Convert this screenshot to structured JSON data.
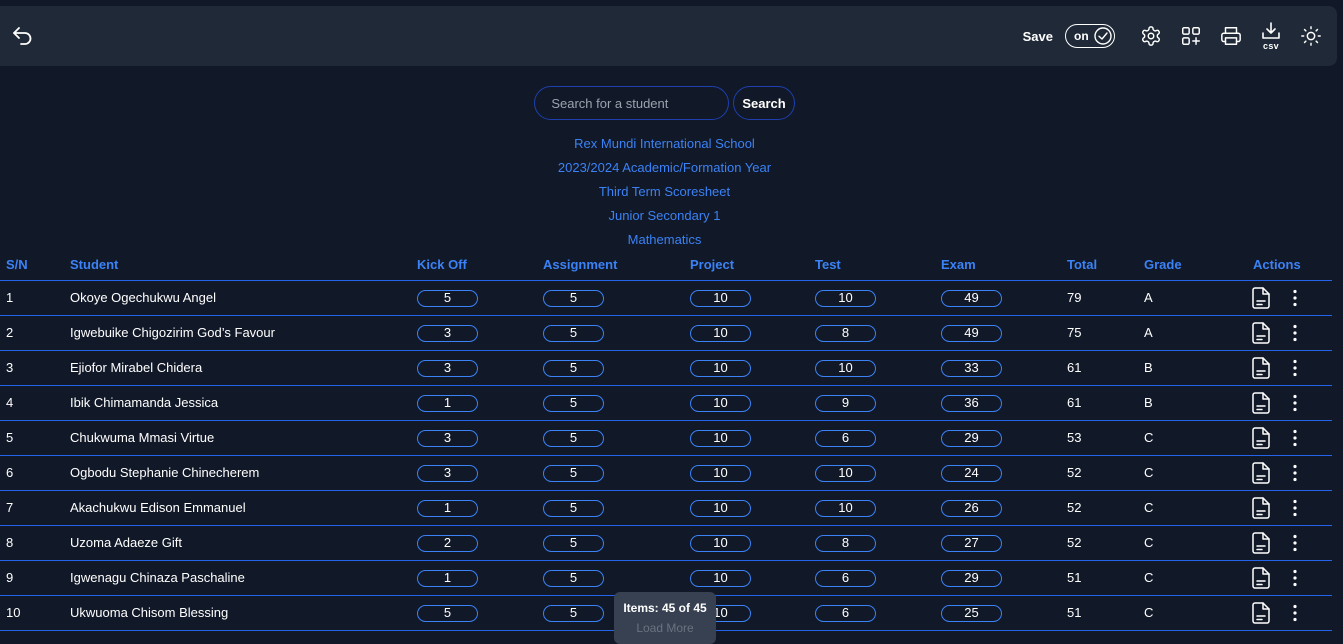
{
  "toolbar": {
    "save_label": "Save",
    "toggle_label": "on",
    "csv_label": "csv"
  },
  "search": {
    "placeholder": "Search for a student",
    "button_label": "Search"
  },
  "heading": [
    "Rex Mundi International School",
    "2023/2024 Academic/Formation Year",
    "Third Term Scoresheet",
    "Junior Secondary 1",
    "Mathematics"
  ],
  "table": {
    "headers": [
      "S/N",
      "Student",
      "Kick Off",
      "Assignment",
      "Project",
      "Test",
      "Exam",
      "Total",
      "Grade",
      "Actions"
    ],
    "rows": [
      {
        "sn": "1",
        "student": "Okoye Ogechukwu Angel",
        "kick_off": "5",
        "assignment": "5",
        "project": "10",
        "test": "10",
        "exam": "49",
        "total": "79",
        "grade": "A"
      },
      {
        "sn": "2",
        "student": "Igwebuike Chigozirim God’s Favour",
        "kick_off": "3",
        "assignment": "5",
        "project": "10",
        "test": "8",
        "exam": "49",
        "total": "75",
        "grade": "A"
      },
      {
        "sn": "3",
        "student": "Ejiofor Mirabel Chidera",
        "kick_off": "3",
        "assignment": "5",
        "project": "10",
        "test": "10",
        "exam": "33",
        "total": "61",
        "grade": "B"
      },
      {
        "sn": "4",
        "student": "Ibik Chimamanda Jessica",
        "kick_off": "1",
        "assignment": "5",
        "project": "10",
        "test": "9",
        "exam": "36",
        "total": "61",
        "grade": "B"
      },
      {
        "sn": "5",
        "student": "Chukwuma Mmasi Virtue",
        "kick_off": "3",
        "assignment": "5",
        "project": "10",
        "test": "6",
        "exam": "29",
        "total": "53",
        "grade": "C"
      },
      {
        "sn": "6",
        "student": "Ogbodu Stephanie Chinecherem",
        "kick_off": "3",
        "assignment": "5",
        "project": "10",
        "test": "10",
        "exam": "24",
        "total": "52",
        "grade": "C"
      },
      {
        "sn": "7",
        "student": "Akachukwu Edison Emmanuel",
        "kick_off": "1",
        "assignment": "5",
        "project": "10",
        "test": "10",
        "exam": "26",
        "total": "52",
        "grade": "C"
      },
      {
        "sn": "8",
        "student": "Uzoma Adaeze Gift",
        "kick_off": "2",
        "assignment": "5",
        "project": "10",
        "test": "8",
        "exam": "27",
        "total": "52",
        "grade": "C"
      },
      {
        "sn": "9",
        "student": "Igwenagu Chinaza Paschaline",
        "kick_off": "1",
        "assignment": "5",
        "project": "10",
        "test": "6",
        "exam": "29",
        "total": "51",
        "grade": "C"
      },
      {
        "sn": "10",
        "student": "Ukwuoma Chisom Blessing",
        "kick_off": "5",
        "assignment": "5",
        "project": "10",
        "test": "6",
        "exam": "25",
        "total": "51",
        "grade": "C"
      }
    ]
  },
  "pager": {
    "count_label": "Items: 45 of 45",
    "load_more_label": "Load More"
  },
  "colors": {
    "background": "#111827",
    "toolbar": "#1f2937",
    "accent": "#3b82f6",
    "divider": "#2563eb"
  },
  "icons": {
    "back": "undo-arrow-icon",
    "settings": "gear-icon",
    "add_widget": "grid-plus-icon",
    "print": "printer-icon",
    "download": "download-icon",
    "theme": "sun-icon",
    "row_document": "document-icon",
    "row_more": "more-vertical-icon"
  }
}
